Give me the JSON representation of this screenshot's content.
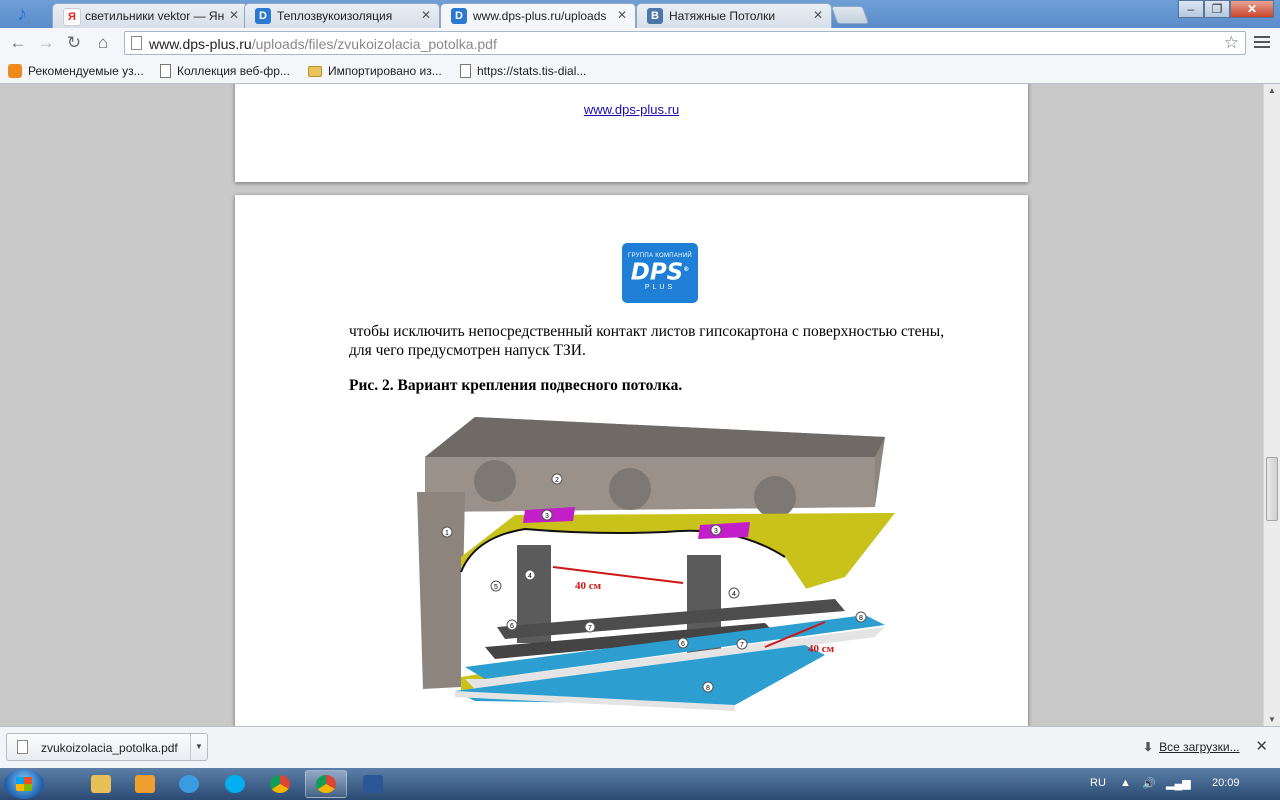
{
  "browser": {
    "tabs": [
      {
        "favicon": "yandex-icon",
        "favicon_letter": "Я",
        "favicon_color": "#ffffff",
        "title": "светильники vektor — Ян",
        "active": false
      },
      {
        "favicon": "dps-site-icon",
        "favicon_letter": "D",
        "favicon_color": "#2a78d0",
        "title": "Теплозвукоизоляция",
        "active": false
      },
      {
        "favicon": "dps-site-icon",
        "favicon_letter": "D",
        "favicon_color": "#2a78d0",
        "title": "www.dps-plus.ru/uploads",
        "active": true
      },
      {
        "favicon": "vk-icon",
        "favicon_letter": "B",
        "favicon_color": "#4a76a8",
        "title": "Натяжные Потолки",
        "active": false
      }
    ],
    "address": {
      "host": "www.dps-plus.ru",
      "path": "/uploads/files/zvukoizolacia_potolka.pdf"
    },
    "bookmarks": [
      {
        "icon": "bulb-icon",
        "label": "Рекомендуемые уз..."
      },
      {
        "icon": "page-icon",
        "label": "Коллекция веб-фр..."
      },
      {
        "icon": "folder-icon",
        "label": "Импортировано из..."
      },
      {
        "icon": "page-icon",
        "label": "https://stats.tis-dial..."
      }
    ]
  },
  "pdf": {
    "prev_page_link": "www.dps-plus.ru",
    "logo": {
      "line1": "ГРУППА КОМПАНИЙ",
      "line2": "DPS",
      "reg": "®",
      "line3": "PLUS"
    },
    "paragraph_line1": "чтобы исключить непосредственный контакт листов гипсокартона с поверхностью стены,",
    "paragraph_line2": "для чего предусмотрен напуск ТЗИ.",
    "figure_caption": "Рис. 2. Вариант крепления подвесного потолка.",
    "figure": {
      "markers": [
        "1",
        "2",
        "3",
        "3",
        "4",
        "4",
        "5",
        "6",
        "6",
        "7",
        "7",
        "8",
        "8"
      ],
      "dim1": "40 см",
      "dim2": "40 см"
    }
  },
  "downloads": {
    "item_name": "zvukoizolacia_potolka.pdf",
    "show_all": "Все загрузки..."
  },
  "taskbar": {
    "lang": "RU",
    "time": "20:09"
  }
}
